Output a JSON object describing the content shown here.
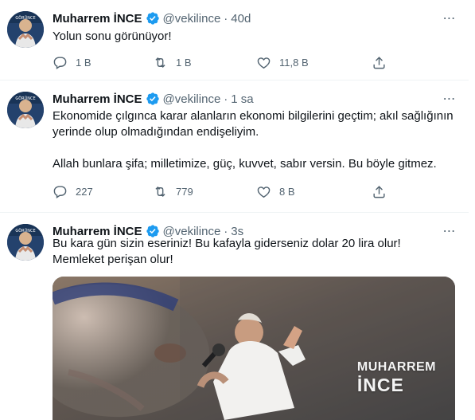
{
  "colors": {
    "verified": "#1d9bf0",
    "text": "#0f1419",
    "secondary": "#536471",
    "divider": "#eff3f4"
  },
  "tweets": [
    {
      "author_name": "Muharrem İNCE",
      "handle": "@vekilince",
      "separator": "·",
      "time": "40d",
      "more": "⋯",
      "text": [
        "Yolun sonu görünüyor!"
      ],
      "replies": "1 B",
      "retweets": "1 B",
      "likes": "11,8 B",
      "icons": [
        "reply-icon",
        "retweet-icon",
        "like-icon",
        "share-icon"
      ]
    },
    {
      "author_name": "Muharrem İNCE",
      "handle": "@vekilince",
      "separator": "·",
      "time": "1 sa",
      "more": "⋯",
      "text": [
        "Ekonomide çılgınca karar alanların ekonomi bilgilerini geçtim; akıl sağlığının yerinde olup olmadığından endişeliyim.",
        "Allah bunlara şifa; milletimize, güç, kuvvet, sabır versin. Bu böyle gitmez."
      ],
      "replies": "227",
      "retweets": "779",
      "likes": "8 B",
      "icons": [
        "reply-icon",
        "retweet-icon",
        "like-icon",
        "share-icon"
      ]
    },
    {
      "author_name": "Muharrem İNCE",
      "handle": "@vekilince",
      "separator": "·",
      "time": "3s",
      "more": "⋯",
      "text": [
        "Bu kara gün sizin eseriniz! Bu kafayla giderseniz dolar 20 lira olur! Memleket perişan olur!"
      ],
      "media": {
        "brand_line1": "MUHARREM",
        "brand_line2": "İNCE"
      }
    }
  ]
}
